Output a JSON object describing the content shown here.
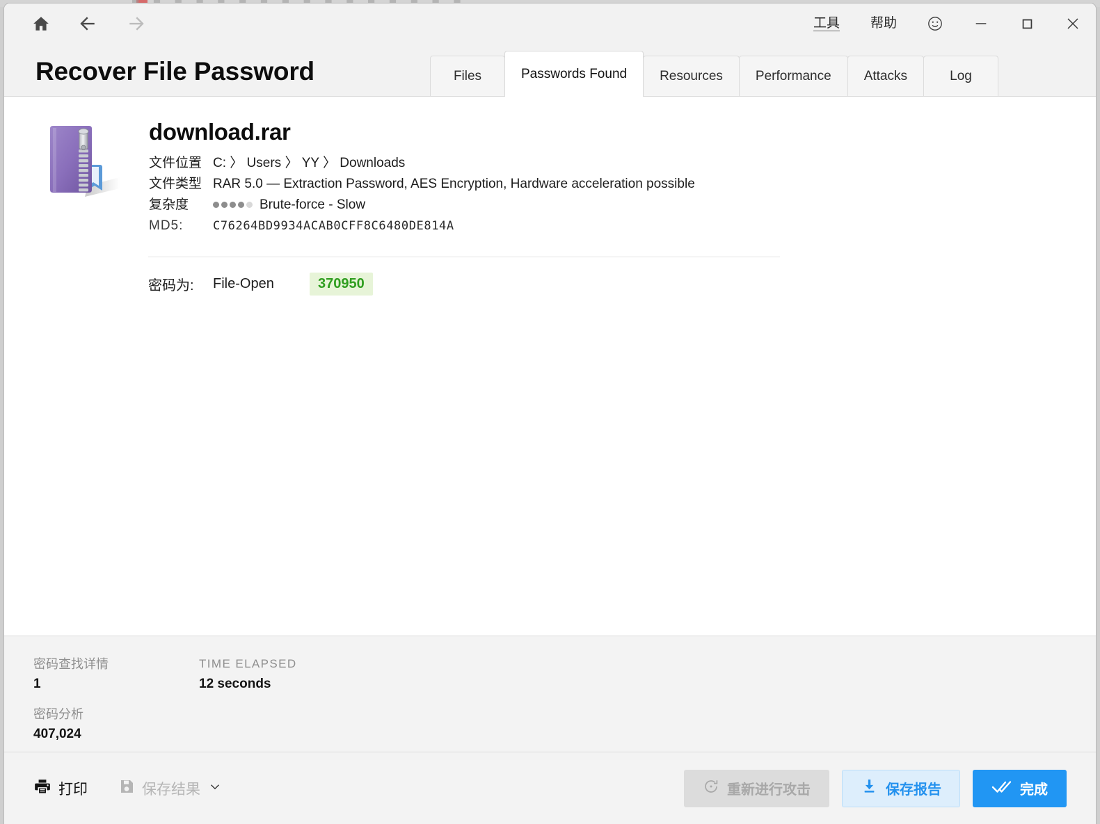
{
  "window": {
    "app_title": "Recover File Password",
    "nav": {
      "home_icon": "home-icon",
      "back_icon": "arrow-left-icon",
      "forward_icon": "arrow-right-icon"
    },
    "menu": [
      {
        "label": "工具",
        "name": "tools"
      },
      {
        "label": "帮助",
        "name": "help"
      }
    ],
    "controls": {
      "feedback_icon": "smiley-icon",
      "minimize_icon": "minimize-icon",
      "maximize_icon": "maximize-icon",
      "close_icon": "close-icon"
    }
  },
  "tabs": [
    {
      "label": "Files",
      "name": "files",
      "active": false
    },
    {
      "label": "Passwords Found",
      "name": "passwords-found",
      "active": true
    },
    {
      "label": "Resources",
      "name": "resources",
      "active": false
    },
    {
      "label": "Performance",
      "name": "performance",
      "active": false
    },
    {
      "label": "Attacks",
      "name": "attacks",
      "active": false
    },
    {
      "label": "Log",
      "name": "log",
      "active": false
    }
  ],
  "file": {
    "icon": "rar-archive-icon",
    "name": "download.rar",
    "location_label": "文件位置",
    "location_value": "C: 〉 Users 〉 YY 〉 Downloads",
    "type_label": "文件类型",
    "type_value": "RAR 5.0 — Extraction Password, AES Encryption, Hardware acceleration possible",
    "complexity_label": "复杂度",
    "complexity_value": "Brute-force - Slow",
    "complexity_filled": 4,
    "complexity_total": 5,
    "md5_label": "MD5:",
    "md5_value": "C76264BD9934ACAB0CFF8C6480DE814A"
  },
  "password": {
    "label": "密码为:",
    "kind": "File-Open",
    "value": "370950",
    "value_color": "#2f9e1f",
    "value_bg": "#e7f4d8"
  },
  "stats": [
    {
      "label": "密码查找详情",
      "value": "1",
      "name": "passwords-found-count"
    },
    {
      "label": "密码分析",
      "value": "407,024",
      "name": "passwords-analyzed-count"
    },
    {
      "label": "TIME ELAPSED",
      "value": "12 seconds",
      "name": "time-elapsed"
    }
  ],
  "actions": {
    "print": {
      "label": "打印",
      "icon": "printer-icon",
      "enabled": true
    },
    "save_results": {
      "label": "保存结果",
      "icon": "floppy-disk-icon",
      "chevron": "chevron-down-icon",
      "enabled": false
    },
    "rerun_attack": {
      "label": "重新进行攻击",
      "icon": "refresh-icon",
      "enabled": false
    },
    "save_report": {
      "label": "保存报告",
      "icon": "download-icon",
      "enabled": true
    },
    "done": {
      "label": "完成",
      "icon": "double-check-icon",
      "enabled": true
    }
  },
  "colors": {
    "accent": "#2196f3",
    "accent_light_bg": "#ddeefc",
    "success": "#2f9e1f",
    "panel": "#f3f3f3",
    "header": "#f2f2f2"
  },
  "background_hint": "█ █ █ █  █ █ █ █  █ █ █ █  █ █ █ █"
}
